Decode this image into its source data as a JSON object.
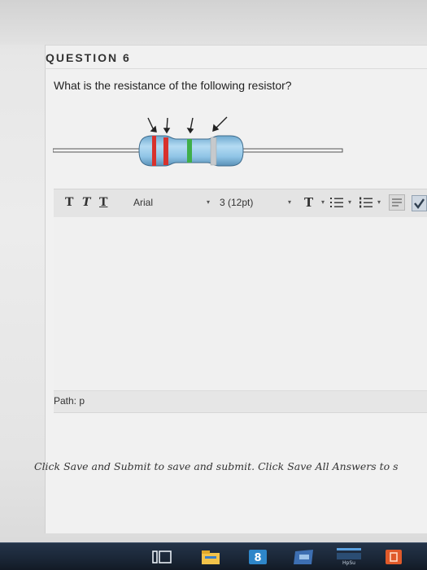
{
  "question": {
    "title": "QUESTION 6",
    "text": "What is the resistance of the following resistor?"
  },
  "resistor_image": {
    "bands": [
      {
        "name": "band-1",
        "color": "#d8312c"
      },
      {
        "name": "band-2",
        "color": "#d8312c"
      },
      {
        "name": "band-3",
        "color": "#3fae49"
      },
      {
        "name": "band-4",
        "color": "#c6c9cc"
      }
    ],
    "body_color": "#8fc4e6",
    "lead_color": "#555555"
  },
  "editor": {
    "toolbar": {
      "bold_label": "T",
      "italic_label": "T",
      "underline_label": "T",
      "font_family": "Arial",
      "font_size": "3 (12pt)",
      "text_color_label": "T",
      "dropdown_arrow": "▾"
    },
    "path_label": "Path: p"
  },
  "instruction": "Click Save and Submit to save and submit. Click Save All Answers to s",
  "taskbar": {
    "icons": [
      "window-switch-icon",
      "file-explorer-icon",
      "app-icon",
      "media-icon",
      "hp-support-icon",
      "store-icon"
    ],
    "hp_label": "HpSu"
  }
}
